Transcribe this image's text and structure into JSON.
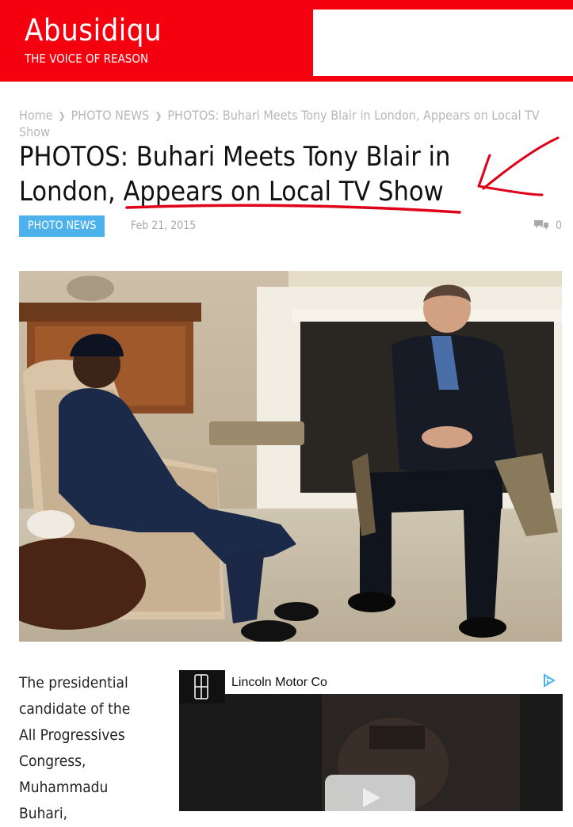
{
  "site": {
    "name": "Abusidiqu",
    "tagline": "THE VOICE OF REASON"
  },
  "breadcrumb": {
    "home": "Home",
    "category": "PHOTO NEWS",
    "current": "PHOTOS: Buhari Meets Tony Blair in London, Appears on Local TV Show"
  },
  "article": {
    "title": "PHOTOS: Buhari Meets Tony Blair in London, Appears on Local TV Show",
    "category": "PHOTO NEWS",
    "date": "Feb 21, 2015",
    "comments": "0",
    "body_lines": [
      "The presidential",
      "candidate of the",
      "All Progressives",
      "Congress,",
      "Muhammadu",
      "Buhari,"
    ]
  },
  "ad": {
    "brand": "Lincoln Motor Co"
  },
  "colors": {
    "header": "#f5000e",
    "category_badge": "#4db2ec",
    "annotation": "#e0001a"
  },
  "icons": {
    "comments": "speech-bubbles-icon",
    "ad": "adchoices-icon",
    "play": "play-icon"
  }
}
